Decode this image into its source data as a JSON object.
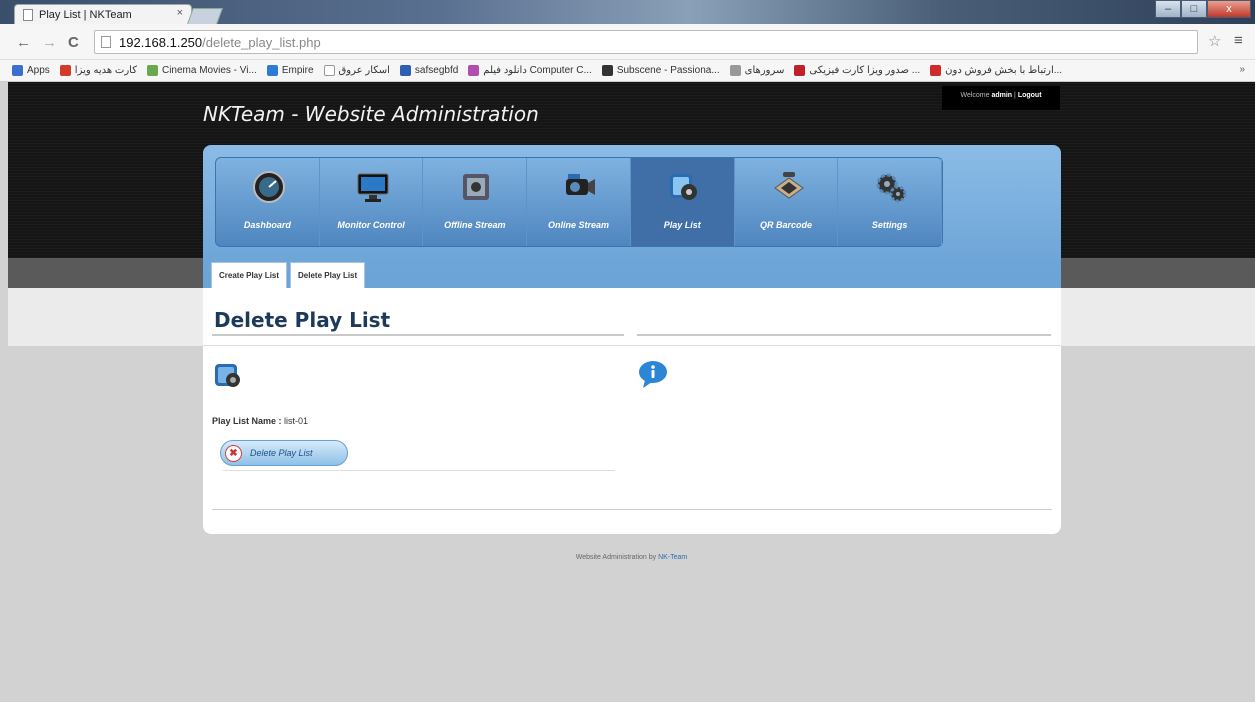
{
  "browser": {
    "tab_title": "Play List | NKTeam",
    "tab_close": "×",
    "url_host": "192.168.1.250",
    "url_path": "/delete_play_list.php",
    "back": "←",
    "forward": "→",
    "reload": "C",
    "star": "☆",
    "menu": "≡",
    "win_min": "–",
    "win_max": "□",
    "win_close": "x",
    "bookmarks": [
      {
        "label": "Apps",
        "color": "#3b6fd0"
      },
      {
        "label": "کارت هدیه ویزا",
        "color": "#d23a2a"
      },
      {
        "label": "Cinema Movies - Vi...",
        "color": "#6aa84f"
      },
      {
        "label": "Empire",
        "color": "#2e7bd6"
      },
      {
        "label": "اسکار عروق",
        "color": "#ffffff"
      },
      {
        "label": "safsegbfd",
        "color": "#2e5fb0"
      },
      {
        "label": "دانلود فیلم Computer C...",
        "color": "#b04fb0"
      },
      {
        "label": "Subscene - Passiona...",
        "color": "#333333"
      },
      {
        "label": "سرورهای",
        "color": "#999999"
      },
      {
        "label": "صدور ویزا کارت فیزیکی ...",
        "color": "#c0202a"
      },
      {
        "label": "ارتباط با بخش فروش دون...",
        "color": "#d02a2a"
      }
    ],
    "bookmarks_more": "»"
  },
  "header": {
    "site_title": "NKTeam - Website Administration",
    "welcome_prefix": "Welcome ",
    "welcome_user": "admin",
    "welcome_sep": " | ",
    "logout": "Logout"
  },
  "nav": [
    {
      "label": "Dashboard",
      "icon": "dashboard-gauge-icon"
    },
    {
      "label": "Monitor Control",
      "icon": "monitor-icon"
    },
    {
      "label": "Offline Stream",
      "icon": "film-reel-icon"
    },
    {
      "label": "Online Stream",
      "icon": "video-camera-icon"
    },
    {
      "label": "Play List",
      "icon": "playlist-media-icon",
      "active": true
    },
    {
      "label": "QR Barcode",
      "icon": "barcode-scanner-icon"
    },
    {
      "label": "Settings",
      "icon": "gears-icon"
    }
  ],
  "subtabs": [
    "Create Play List",
    "Delete Play List"
  ],
  "content": {
    "heading": "Delete Play List",
    "field_label": "Play List Name : ",
    "field_value": "list-01",
    "delete_button": "Delete Play List",
    "delete_button_icon": "✖"
  },
  "footer": {
    "text": "Website Administration by ",
    "link": "NK-Team"
  },
  "colors": {
    "header_bg": "#151515",
    "panel_blue": "#6ea5d8",
    "active_nav": "#3f6fa6",
    "heading": "#1e3a5a"
  }
}
